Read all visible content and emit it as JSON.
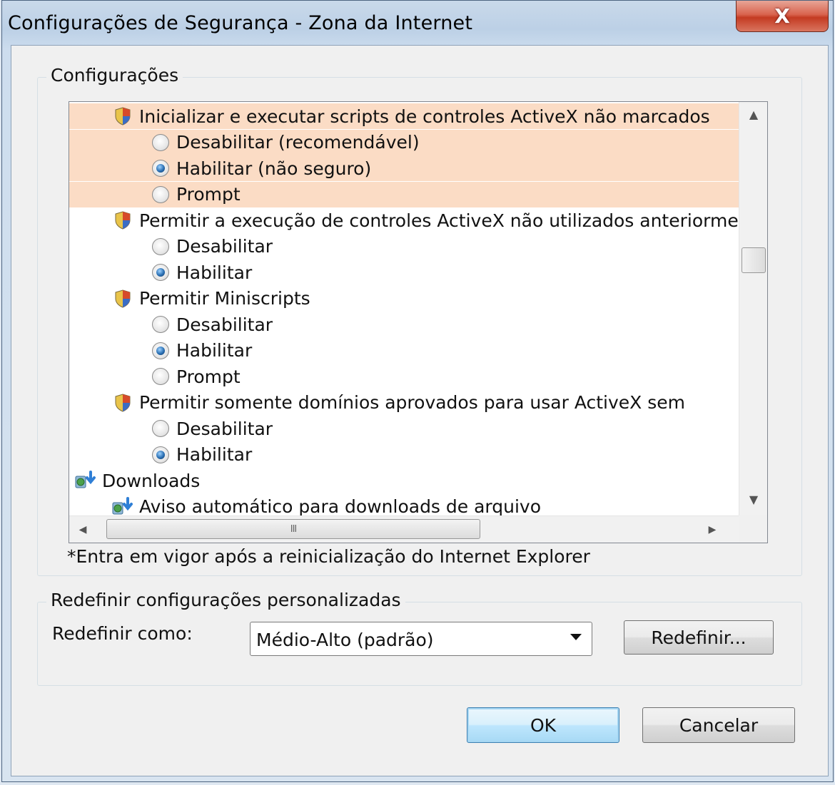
{
  "window": {
    "title": "Configurações de Segurança - Zona da Internet",
    "close_glyph": "X"
  },
  "settings_group": {
    "label": "Configurações"
  },
  "list_rows": [
    {
      "text": "Inicializar e executar scripts de controles ActiveX não marcados",
      "kind": "setting",
      "highlight": true
    },
    {
      "text": "Desabilitar (recomendável)",
      "kind": "option",
      "checked": false,
      "highlight": true
    },
    {
      "text": "Habilitar (não seguro)",
      "kind": "option",
      "checked": true,
      "highlight": true
    },
    {
      "text": "Prompt",
      "kind": "option",
      "checked": false,
      "highlight": true
    },
    {
      "text": "Permitir a execução de controles ActiveX não utilizados anteriormente",
      "kind": "setting",
      "highlight": false
    },
    {
      "text": "Desabilitar",
      "kind": "option",
      "checked": false,
      "highlight": false
    },
    {
      "text": "Habilitar",
      "kind": "option",
      "checked": true,
      "highlight": false
    },
    {
      "text": "Permitir Miniscripts",
      "kind": "setting",
      "highlight": false
    },
    {
      "text": "Desabilitar",
      "kind": "option",
      "checked": false,
      "highlight": false
    },
    {
      "text": "Habilitar",
      "kind": "option",
      "checked": true,
      "highlight": false
    },
    {
      "text": "Prompt",
      "kind": "option",
      "checked": false,
      "highlight": false
    },
    {
      "text": "Permitir somente domínios aprovados para usar ActiveX sem",
      "kind": "setting",
      "highlight": false
    },
    {
      "text": "Desabilitar",
      "kind": "option",
      "checked": false,
      "highlight": false
    },
    {
      "text": "Habilitar",
      "kind": "option",
      "checked": true,
      "highlight": false
    },
    {
      "text": "Downloads",
      "kind": "category",
      "highlight": false
    },
    {
      "text": "Aviso automático para downloads de arquivo",
      "kind": "subcategory",
      "highlight": false
    }
  ],
  "scrollbar": {
    "hthumb_grip": "III"
  },
  "note": "*Entra em vigor após a reinicialização do Internet Explorer",
  "reset_group": {
    "label": "Redefinir configurações personalizadas",
    "reset_as_label": "Redefinir como:",
    "selected_level": "Médio-Alto (padrão)",
    "reset_button": "Redefinir..."
  },
  "buttons": {
    "ok": "OK",
    "cancel": "Cancelar"
  },
  "colors": {
    "highlight_row": "#fbdcc5",
    "close_button": "#c43b22",
    "dialog_bg": "#f0f0f0"
  }
}
